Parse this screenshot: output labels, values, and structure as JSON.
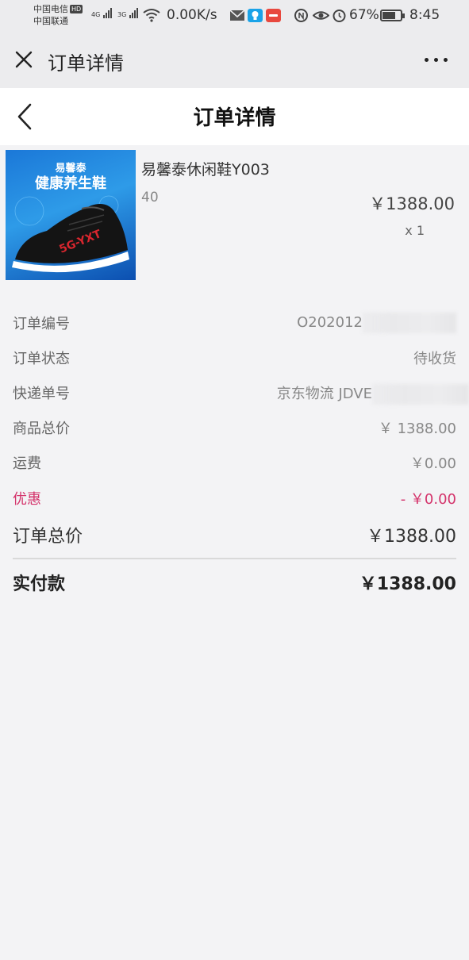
{
  "status_bar": {
    "carrier_1": "中国电信",
    "carrier_1_badge": "HD",
    "carrier_2": "中国联通",
    "signal_1": "4G",
    "signal_2": "3G",
    "net_speed": "0.00K/s",
    "battery": "67%",
    "time": "8:45"
  },
  "top_nav": {
    "title": "订单详情"
  },
  "page_header": {
    "title": "订单详情"
  },
  "product": {
    "thumb_brand": "易馨泰",
    "thumb_slogan": "健康养生鞋",
    "thumb_model": "5G-YXT",
    "name": "易馨泰休闲鞋Y003",
    "spec": "40",
    "price": "￥1388.00",
    "quantity": "x 1"
  },
  "order": {
    "order_no_label": "订单编号",
    "order_no_value": "O202012",
    "status_label": "订单状态",
    "status_value": "待收货",
    "tracking_label": "快递单号",
    "tracking_value": "京东物流 JDVE",
    "goods_total_label": "商品总价",
    "goods_total_value": "￥ 1388.00",
    "shipping_label": "运费",
    "shipping_value": "￥0.00",
    "discount_label": "优惠",
    "discount_value": "- ￥0.00",
    "order_total_label": "订单总价",
    "order_total_value": "￥1388.00",
    "paid_label": "实付款",
    "paid_value": "￥1388.00"
  },
  "colors": {
    "discount": "#d4336b",
    "nav_bg": "#ececee",
    "page_bg": "#f3f3f5"
  }
}
